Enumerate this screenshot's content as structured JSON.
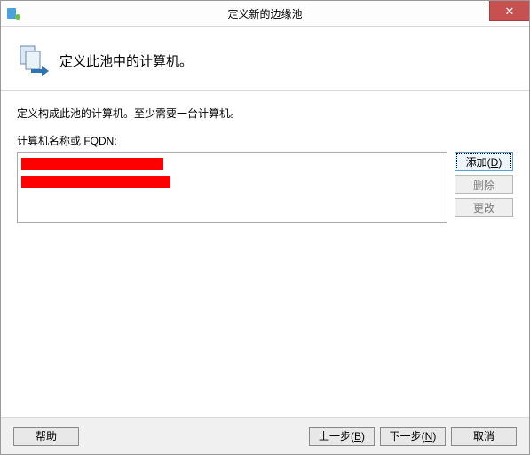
{
  "titlebar": {
    "title": "定义新的边缘池",
    "close_label": "✕"
  },
  "header": {
    "title": "定义此池中的计算机。"
  },
  "body": {
    "description": "定义构成此池的计算机。至少需要一台计算机。",
    "field_label": "计算机名称或 FQDN:"
  },
  "side_buttons": {
    "add_prefix": "添加(",
    "add_key": "D",
    "add_suffix": ")",
    "remove": "删除",
    "change": "更改"
  },
  "footer": {
    "help": "帮助",
    "back_prefix": "上一步(",
    "back_key": "B",
    "back_suffix": ")",
    "next_prefix": "下一步(",
    "next_key": "N",
    "next_suffix": ")",
    "cancel": "取消"
  }
}
